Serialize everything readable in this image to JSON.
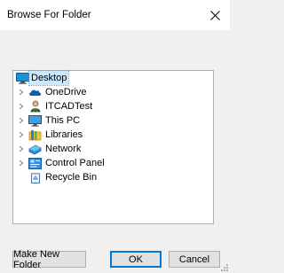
{
  "window": {
    "title": "Browse For Folder",
    "close_glyph": "✕"
  },
  "tree": {
    "items": [
      {
        "label": "Desktop",
        "icon": "desktop-icon",
        "expandable": false,
        "selected": true,
        "level": 0
      },
      {
        "label": "OneDrive",
        "icon": "onedrive-cloud-icon",
        "expandable": true,
        "selected": false,
        "level": 1
      },
      {
        "label": "ITCADTest",
        "icon": "user-folder-icon",
        "expandable": true,
        "selected": false,
        "level": 1
      },
      {
        "label": "This PC",
        "icon": "computer-icon",
        "expandable": true,
        "selected": false,
        "level": 1
      },
      {
        "label": "Libraries",
        "icon": "libraries-icon",
        "expandable": true,
        "selected": false,
        "level": 1
      },
      {
        "label": "Network",
        "icon": "network-icon",
        "expandable": true,
        "selected": false,
        "level": 1
      },
      {
        "label": "Control Panel",
        "icon": "control-panel-icon",
        "expandable": true,
        "selected": false,
        "level": 1
      },
      {
        "label": "Recycle Bin",
        "icon": "recycle-bin-icon",
        "expandable": false,
        "selected": false,
        "level": 1
      }
    ],
    "expander_glyph": "›"
  },
  "buttons": {
    "make_new_folder": "Make New Folder",
    "ok": "OK",
    "cancel": "Cancel"
  },
  "colors": {
    "selection": "#cce8ff",
    "accent": "#0078d7"
  }
}
